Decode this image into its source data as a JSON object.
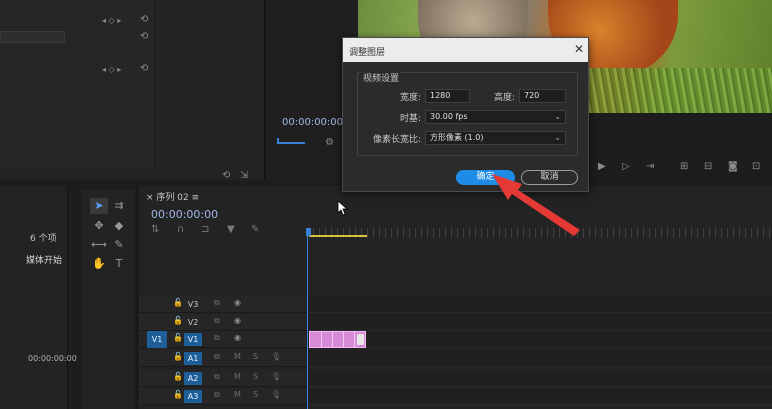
{
  "effect_controls": {
    "reset_glyph": "⟲",
    "keyframe_glyph": "◂ ◇ ▸"
  },
  "source_monitor": {
    "timecode": "00:00:00:00"
  },
  "project": {
    "item_count": "6 个项",
    "column_header": "媒体开始",
    "row_timecode": "00:00:00:00"
  },
  "sequence": {
    "tab_label": "序列 02",
    "timecode": "00:00:00:00",
    "tracks": [
      {
        "name": "V3",
        "target": false
      },
      {
        "name": "V2",
        "target": false
      },
      {
        "name": "V1",
        "target": true
      },
      {
        "name": "A1",
        "target": true
      },
      {
        "name": "A2",
        "target": true
      },
      {
        "name": "A3",
        "target": true
      }
    ],
    "source_patch": "V1",
    "audio_m": "M",
    "audio_s": "S"
  },
  "dialog": {
    "title": "调整图层",
    "close_glyph": "✕",
    "group_label": "视频设置",
    "width_label": "宽度:",
    "width_value": "1280",
    "height_label": "高度:",
    "height_value": "720",
    "timebase_label": "时基:",
    "timebase_value": "30.00 fps",
    "par_label": "像素长宽比:",
    "par_value": "方形像素 (1.0)",
    "ok_label": "确定",
    "cancel_label": "取消"
  },
  "colors": {
    "accent": "#1e8be6",
    "annotation": "#e53935",
    "clip": "#d78ad7"
  }
}
